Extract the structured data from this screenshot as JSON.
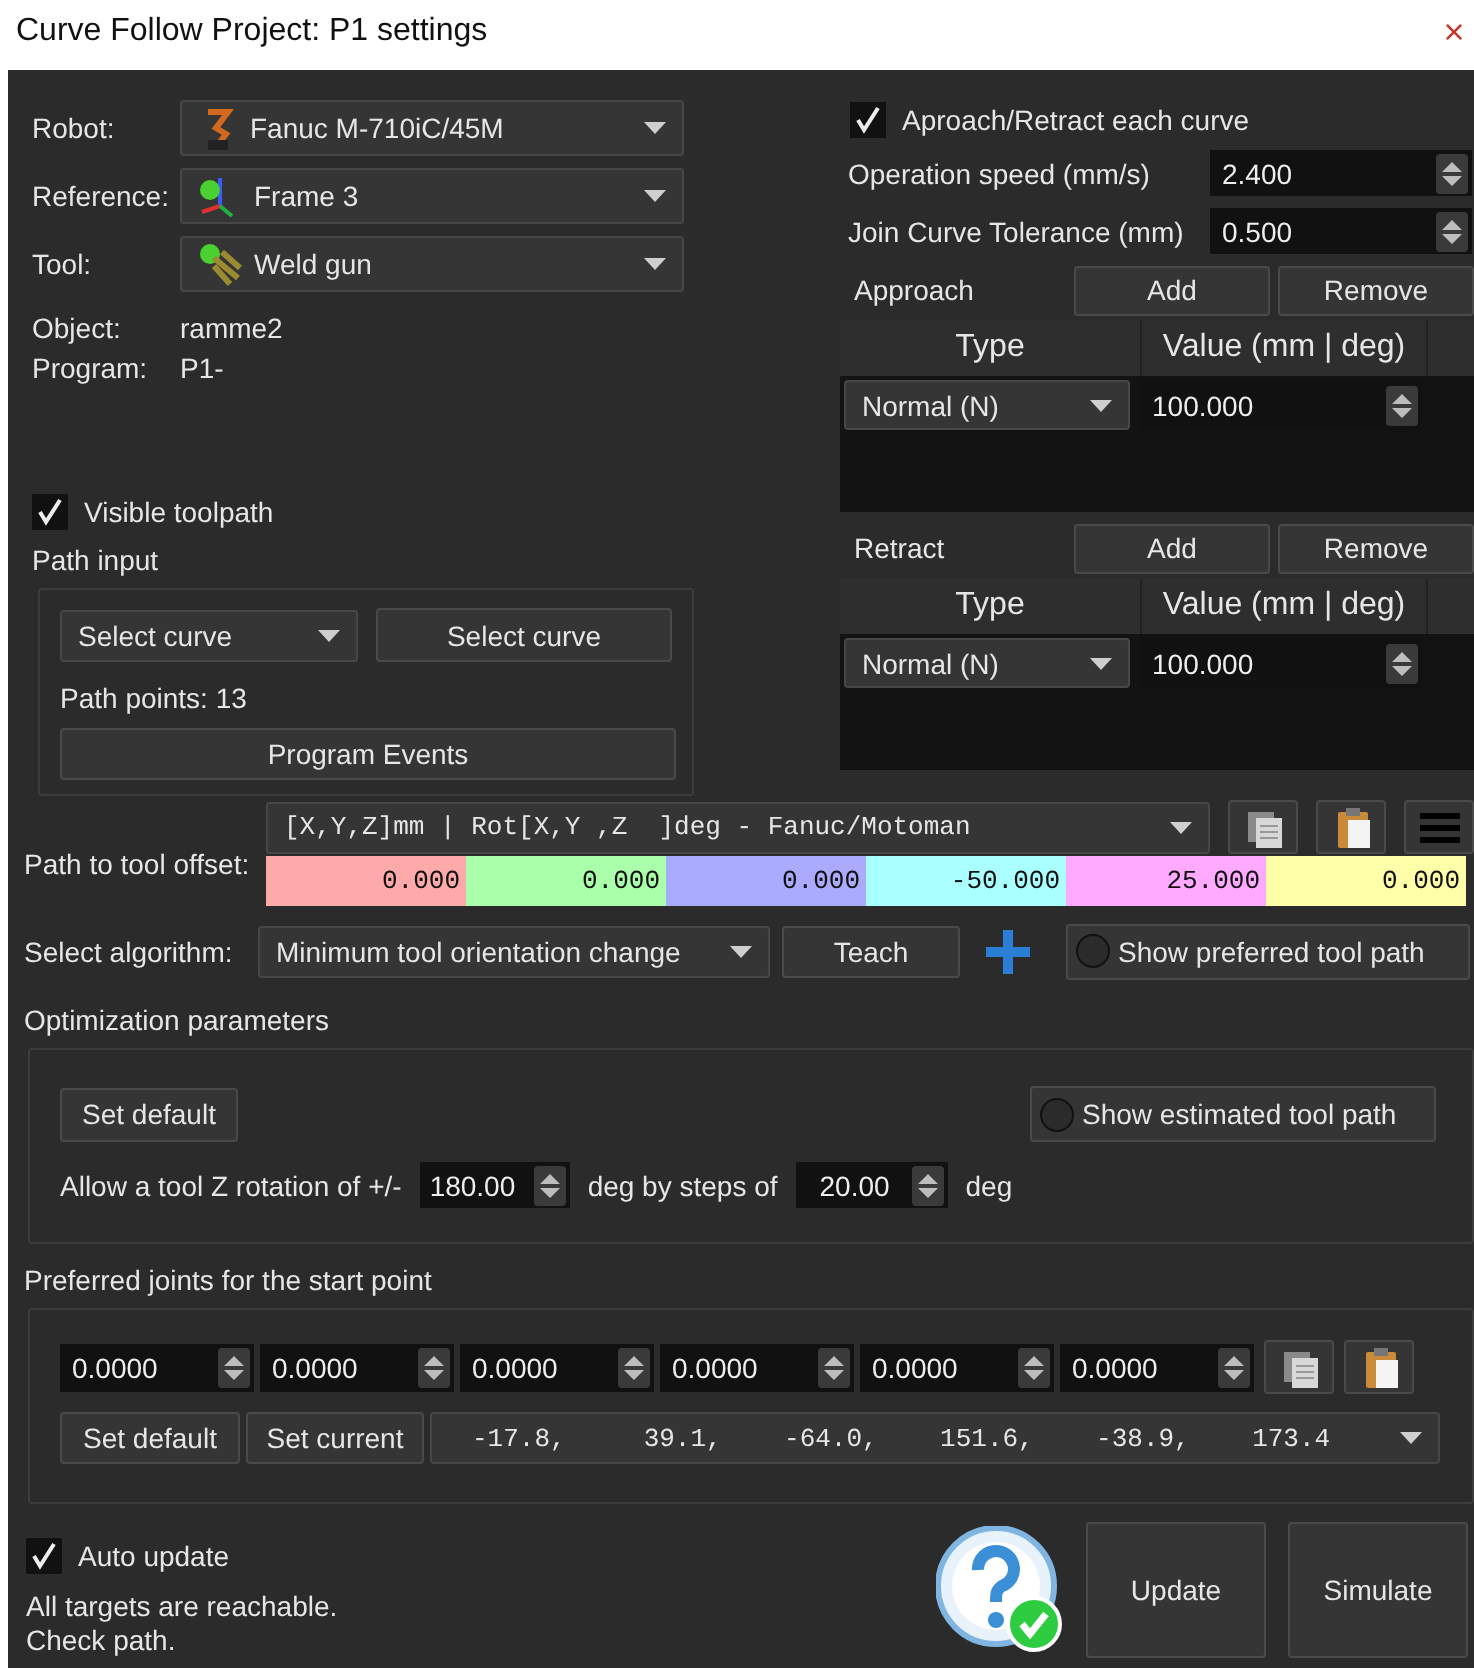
{
  "window": {
    "title": "Curve Follow Project: P1 settings",
    "close": "×"
  },
  "selectors": [
    {
      "kind": "robot",
      "label": "Robot:",
      "value": "Fanuc M-710iC/45M"
    },
    {
      "kind": "frame",
      "label": "Reference:",
      "value": "Frame 3"
    },
    {
      "kind": "tool",
      "label": "Tool:",
      "value": "Weld gun"
    }
  ],
  "info": [
    {
      "label": "Object:",
      "value": "ramme2"
    },
    {
      "label": "Program:",
      "value": "P1-"
    }
  ],
  "visible_toolpath": {
    "label": "Visible toolpath",
    "checked": true
  },
  "path_input": {
    "title": "Path input",
    "curve_combo": "Select curve",
    "select_button": "Select curve",
    "path_points": "Path points: 13",
    "events_button": "Program Events"
  },
  "approach_retract": {
    "label": "Aproach/Retract each curve",
    "checked": true
  },
  "speed_fields": [
    {
      "label": "Operation speed (mm/s)",
      "value": "2.400"
    },
    {
      "label": "Join Curve Tolerance (mm)",
      "value": "0.500"
    }
  ],
  "motion_tables": [
    {
      "title": "Approach",
      "add": "Add",
      "remove": "Remove",
      "columns": [
        "Type",
        "Value (mm | deg)"
      ],
      "rows": [
        {
          "type": "Normal (N)",
          "value": "100.000"
        }
      ]
    },
    {
      "title": "Retract",
      "add": "Add",
      "remove": "Remove",
      "columns": [
        "Type",
        "Value (mm | deg)"
      ],
      "rows": [
        {
          "type": "Normal (N)",
          "value": "100.000"
        }
      ]
    }
  ],
  "offset": {
    "label": "Path to tool offset:",
    "format": "[X,Y,Z]mm | Rot[X,Y ,Z  ]deg - Fanuc/Motoman",
    "values": [
      {
        "value": "0.000",
        "color": "#ffaaaa"
      },
      {
        "value": "0.000",
        "color": "#aaffaa"
      },
      {
        "value": "0.000",
        "color": "#aaaaff"
      },
      {
        "value": "-50.000",
        "color": "#aaffff"
      },
      {
        "value": "25.000",
        "color": "#ffaaff"
      },
      {
        "value": "0.000",
        "color": "#ffffaa"
      }
    ]
  },
  "algorithm": {
    "label": "Select algorithm:",
    "value": "Minimum tool orientation change",
    "teach": "Teach",
    "preferred_toggle": {
      "label": "Show preferred tool path",
      "selected": false
    }
  },
  "optimization": {
    "title": "Optimization parameters",
    "set_default": "Set default",
    "estimated_toggle": {
      "label": "Show estimated tool path",
      "selected": false
    },
    "rotation_prefix": "Allow a tool Z rotation of +/-",
    "rotation": "180.00",
    "steps_text": "deg by steps of",
    "step": "20.00",
    "unit": "deg"
  },
  "preferred_joints": {
    "title": "Preferred joints for the start point",
    "joints": [
      "0.0000",
      "0.0000",
      "0.0000",
      "0.0000",
      "0.0000",
      "0.0000"
    ],
    "set_default": "Set default",
    "set_current": "Set current",
    "current": "-17.8,     39.1,    -64.0,    151.6,    -38.9,    173.4"
  },
  "auto_update": {
    "label": "Auto update",
    "checked": true
  },
  "status": [
    "All targets are reachable.",
    "Check path."
  ],
  "buttons": [
    "Update",
    "Simulate"
  ]
}
